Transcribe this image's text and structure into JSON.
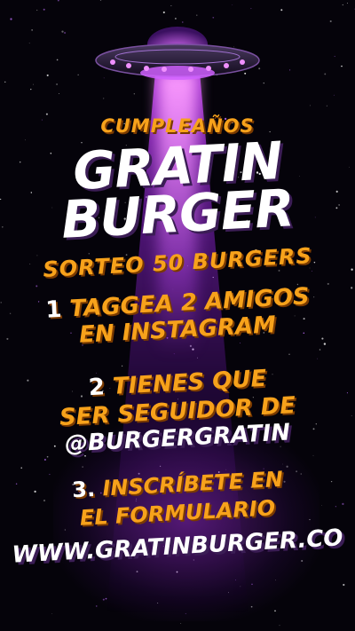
{
  "poster": {
    "heading_small": "CUMPLEAÑOS",
    "title_line1": "GRATIN",
    "title_line2": "BURGER",
    "subtitle": "SORTEO 50 BURGERS",
    "steps": [
      {
        "number": "1",
        "line1": "TAGGEA 2 AMIGOS",
        "line2": "EN INSTAGRAM"
      },
      {
        "number": "2",
        "line1": "TIENES QUE",
        "line2": "SER SEGUIDOR DE",
        "handle": "@BURGERGRATIN"
      },
      {
        "number": "3.",
        "line1": "INSCRÍBETE EN",
        "line2": "EL FORMULARIO",
        "url": "WWW.GRATINBURGER.CO"
      }
    ]
  },
  "colors": {
    "background": "#05030a",
    "accent_orange": "#f7a21b",
    "beam_purple": "#b040f0",
    "text_white": "#ffffff"
  },
  "icons": {
    "ufo": "ufo-icon"
  }
}
